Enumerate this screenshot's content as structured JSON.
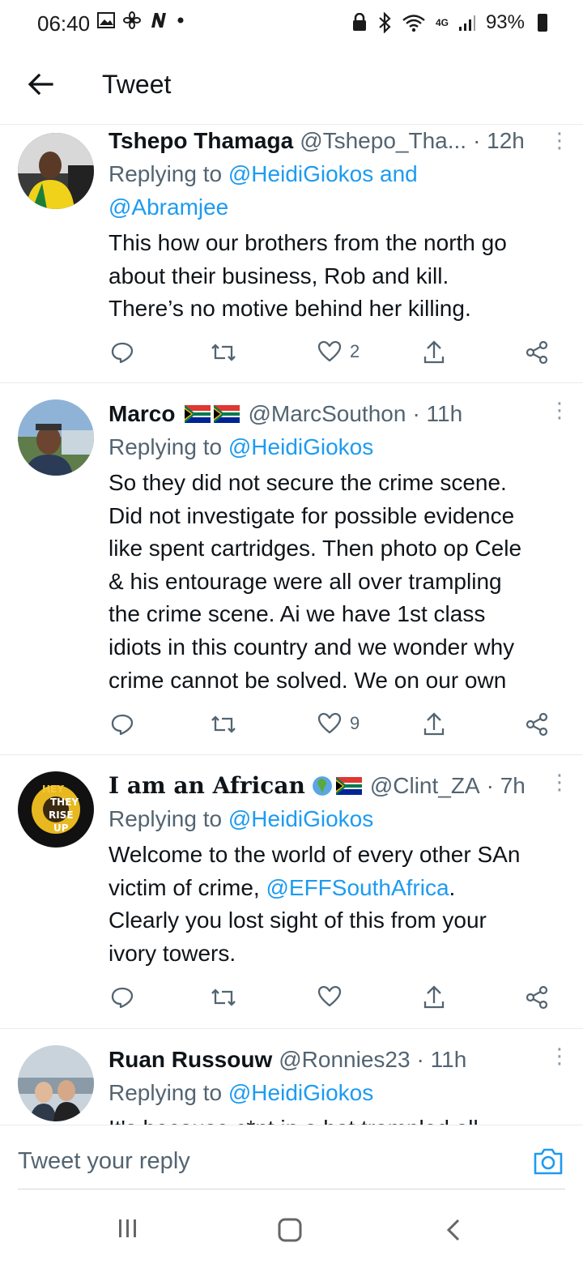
{
  "status_bar": {
    "time": "06:40",
    "left_icons": [
      "image-icon",
      "fan-icon",
      "n-icon",
      "dot-icon"
    ],
    "network": "4G",
    "battery": "93%"
  },
  "header": {
    "title": "Tweet",
    "back_icon": "arrow-left-icon"
  },
  "tweets": [
    {
      "name": "Tshepo Thamaga",
      "handle": "@Tshepo_Tha...",
      "time": "· 12h",
      "replying_prefix": "Replying to",
      "replying_to": "@HeidiGiokos and",
      "replying_to_2": "@Abramjee",
      "lines": [
        "This how our brothers from the north go",
        "about their business, Rob and kill.",
        "There’s no motive behind her killing."
      ],
      "likes": "2"
    },
    {
      "name": "Marco",
      "handle": "@MarcSouthon",
      "time": "· 11h",
      "replying_prefix": "Replying to",
      "replying_to": "@HeidiGiokos",
      "lines": [
        "So they did not secure the crime scene.",
        "Did not investigate for possible evidence",
        "like spent cartridges. Then photo op Cele",
        "& his entourage were all over trampling",
        "the crime scene. Ai we have 1st class",
        "idiots in this country and we wonder why",
        "crime cannot be solved. We on our own"
      ],
      "likes": "9"
    },
    {
      "name": "I am an African",
      "handle": "@Clint_ZA",
      "time": "· 7h",
      "replying_prefix": "Replying to",
      "replying_to": "@HeidiGiokos",
      "line1": "Welcome to the world of every other SAn",
      "line2_prefix": "victim of crime, ",
      "line2_mention": "@EFFSouthAfrica",
      "line2_suffix": ".",
      "line3": "Clearly you lost sight of this from your",
      "line4": "ivory towers.",
      "avatar_text": [
        "HEY",
        "THEY",
        "RISE",
        "UP"
      ]
    },
    {
      "name": "Ruan Russouw",
      "handle": "@Ronnies23",
      "time": "· 11h",
      "replying_prefix": "Replying to",
      "replying_to": "@HeidiGiokos",
      "partial_line": "It's because c*nt in a hat trampled all"
    }
  ],
  "reply_bar": {
    "placeholder": "Tweet your reply",
    "camera_icon": "camera-icon"
  },
  "nav": {
    "icons": [
      "recent-apps-icon",
      "home-icon",
      "back-icon"
    ]
  },
  "colors": {
    "accent": "#1d9bf0",
    "secondary_text": "#536471",
    "divider": "#e6ecf0"
  }
}
